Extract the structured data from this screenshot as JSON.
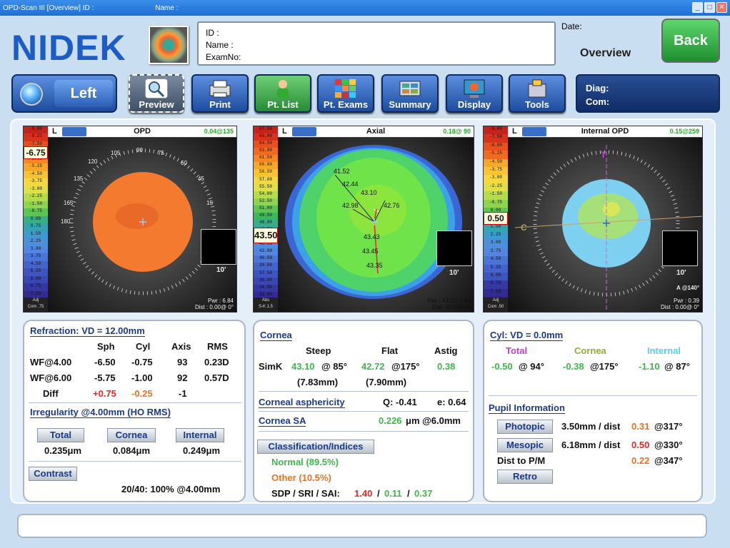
{
  "window": {
    "title": "OPD-Scan III  [Overview]  ID :",
    "name_label": "Name :"
  },
  "header": {
    "logo": "NIDEK",
    "id_label": "ID :",
    "name_label": "Name :",
    "exam_label": "ExamNo:",
    "date_label": "Date:",
    "view": "Overview",
    "back": "Back"
  },
  "toolbar": {
    "eye": "Left",
    "preview": "Preview",
    "print": "Print",
    "pt_list": "Pt. List",
    "pt_exams": "Pt. Exams",
    "summary": "Summary",
    "display": "Display",
    "tools": "Tools",
    "diag": "Diag:",
    "com": "Com:"
  },
  "maps": [
    {
      "eye": "L",
      "title": "OPD",
      "value": "0.04@135",
      "selected": "-6.75",
      "scale_top": [
        "-8.00",
        "-8.21",
        "-7.50",
        "-6.75",
        "-6.00",
        "-5.25",
        "-4.50",
        "-3.75",
        "-3.00",
        "-2.25",
        "-1.50",
        "-0.75",
        "0.00",
        "0.75",
        "1.50",
        "2.25",
        "3.00",
        "3.75",
        "4.50",
        "5.25",
        "6.00",
        "6.75",
        "7.50",
        "8.25",
        "9.00"
      ],
      "adj": "Adj",
      "com": "Com .75",
      "pwr": "Pwr :  6.84",
      "dist": "Dist : 0.00@  0°",
      "thumb": "10'"
    },
    {
      "eye": "L",
      "title": "Axial",
      "value": "0.18@ 90",
      "selected": "43.50",
      "scale_top": [
        "67.50",
        "66.00",
        "64.50",
        "63.00",
        "61.50",
        "60.00",
        "58.50",
        "57.00",
        "55.50",
        "54.00",
        "52.50",
        "51.00",
        "49.50",
        "48.00",
        "46.50",
        "45.00",
        "43.50",
        "42.00",
        "40.50",
        "39.00",
        "37.50",
        "36.00",
        "34.50",
        "33.00",
        "31.50",
        "30.00"
      ],
      "adj": "Abs",
      "com": "S-K 1.5",
      "pwr": "Pwr : 43.07/ 7.84",
      "dist": "Dist : 0.00@  0°",
      "thumb": "10'",
      "labels": [
        "41.52",
        "42.44",
        "43.10",
        "42.98",
        "42.76",
        "43.43",
        "43.45",
        "43.35"
      ]
    },
    {
      "eye": "L",
      "title": "Internal OPD",
      "value": "0.15@259",
      "selected": "0.50",
      "scale_top": [
        "-8.00",
        "-7.50",
        "-6.00",
        "-5.25",
        "-4.50",
        "-3.75",
        "-3.00",
        "-2.25",
        "-1.50",
        "-0.75",
        "0.00",
        "0.50",
        "1.50",
        "2.25",
        "3.00",
        "3.75",
        "4.50",
        "5.25",
        "6.00",
        "6.75",
        "7.50",
        "8.25",
        "9.00"
      ],
      "adj": "Adj",
      "com": "Com .50",
      "pwr": "Pwr :  0.39",
      "dist": "Dist : 0.00@  0°",
      "thumb": "10'",
      "angle": "A @140°"
    }
  ],
  "refraction": {
    "title": "Refraction: VD = 12.00mm",
    "headers": [
      "Sph",
      "Cyl",
      "Axis",
      "RMS"
    ],
    "rows": [
      {
        "label": "WF@4.00",
        "sph": "-6.50",
        "cyl": "-0.75",
        "axis": "93",
        "rms": "0.23D"
      },
      {
        "label": "WF@6.00",
        "sph": "-5.75",
        "cyl": "-1.00",
        "axis": "92",
        "rms": "0.57D"
      },
      {
        "label": "Diff",
        "sph": "+0.75",
        "cyl": "-0.25",
        "axis": "-1",
        "rms": ""
      }
    ],
    "irregularity": "Irregularity @4.00mm (HO RMS)",
    "total_btn": "Total",
    "cornea_btn": "Cornea",
    "internal_btn": "Internal",
    "total_val": "0.235μm",
    "cornea_val": "0.084μm",
    "internal_val": "0.249μm",
    "contrast_btn": "Contrast",
    "contrast_val": "20/40: 100%  @4.00mm"
  },
  "cornea": {
    "title": "Cornea",
    "steep": "Steep",
    "flat": "Flat",
    "astig": "Astig",
    "simk": "SimK",
    "steep_val": "43.10",
    "steep_axis": "@ 85°",
    "flat_val": "42.72",
    "flat_axis": "@175°",
    "astig_val": "0.38",
    "steep_mm": "(7.83mm)",
    "flat_mm": "(7.90mm)",
    "asph_title": "Corneal asphericity",
    "q": "Q: -0.41",
    "e": "e: 0.64",
    "sa_title": "Cornea SA",
    "sa_val": "0.226",
    "sa_unit": "μm @6.0mm",
    "class_btn": "Classification/Indices",
    "normal": "Normal (89.5%)",
    "other": "Other (10.5%)",
    "idx_label": "SDP / SRI / SAI:",
    "sdp": "1.40",
    "sri": "0.11",
    "sai": "0.37",
    "slash": "/"
  },
  "cyl": {
    "title": "Cyl: VD = 0.0mm",
    "total": "Total",
    "cornea": "Cornea",
    "internal": "Internal",
    "total_val": "-0.50",
    "total_axis": "@ 94°",
    "cornea_val": "-0.38",
    "cornea_axis": "@175°",
    "internal_val": "-1.10",
    "internal_axis": "@ 87°",
    "pupil_title": "Pupil Information",
    "photopic": "Photopic",
    "photopic_val": "3.50mm / dist",
    "photopic_d": "0.31",
    "photopic_a": "@317°",
    "mesopic": "Mesopic",
    "mesopic_val": "6.18mm / dist",
    "mesopic_d": "0.50",
    "mesopic_a": "@330°",
    "pm_label": "Dist to P/M",
    "pm_d": "0.22",
    "pm_a": "@347°",
    "retro": "Retro"
  }
}
